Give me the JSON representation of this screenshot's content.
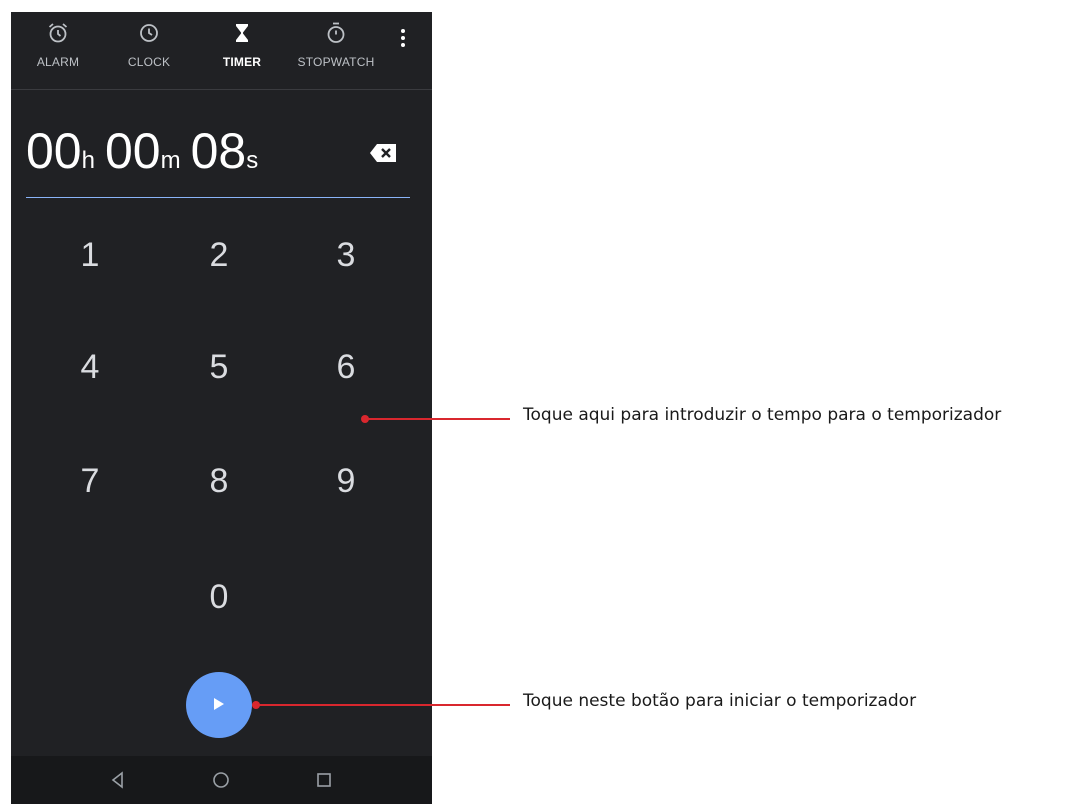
{
  "tabs": {
    "alarm": {
      "label": "ALARM",
      "icon": "alarm-icon"
    },
    "clock": {
      "label": "CLOCK",
      "icon": "clock-icon"
    },
    "timer": {
      "label": "TIMER",
      "icon": "hourglass-icon",
      "active": true
    },
    "stopwatch": {
      "label": "STOPWATCH",
      "icon": "stopwatch-icon"
    }
  },
  "display": {
    "hours": "00",
    "hours_unit": "h",
    "minutes": "00",
    "minutes_unit": "m",
    "seconds": "08",
    "seconds_unit": "s"
  },
  "keypad": {
    "k1": "1",
    "k2": "2",
    "k3": "3",
    "k4": "4",
    "k5": "5",
    "k6": "6",
    "k7": "7",
    "k8": "8",
    "k9": "9",
    "k0": "0"
  },
  "callouts": {
    "keypad": "Toque aqui para introduzir o tempo para o temporizador",
    "start": "Toque neste botão para iniciar o temporizador"
  },
  "colors": {
    "background": "#202124",
    "accent": "#669df6",
    "callout": "#d9272e"
  }
}
